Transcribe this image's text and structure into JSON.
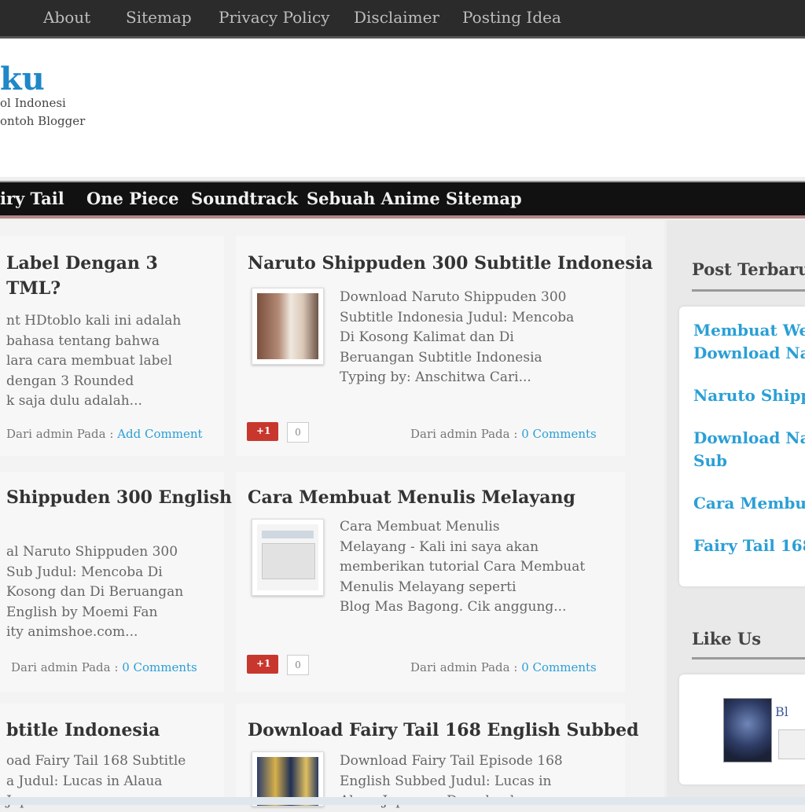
{
  "top_nav": [
    "About",
    "Sitemap",
    "Privacy Policy",
    "Disclaimer",
    "Posting Idea"
  ],
  "header": {
    "title": "ku",
    "desc_line1": "ol Indonesi",
    "desc_line2": "ontoh Blogger"
  },
  "main_nav": [
    "iry Tail",
    "One Piece",
    "Soundtrack",
    "Sebuah Anime",
    "Sitemap"
  ],
  "posts": [
    {
      "title1": "Label Dengan 3",
      "title2": "TML?",
      "snippet": [
        "nt HDtoblo kali ini adalah",
        "bahasa tentang bahwa",
        "lara cara membuat label",
        "dengan 3 Rounded",
        "k saja dulu adalah..."
      ],
      "meta_prefix": "Dari admin Pada :",
      "comments": "Add Comment"
    },
    {
      "title1": "Naruto Shippuden 300 Subtitle Indonesia",
      "snippet": [
        "Download Naruto Shippuden 300",
        "Subtitle Indonesia Judul: Mencoba",
        "Di Kosong Kalimat dan Di",
        "Beruangan Subtitle Indonesia",
        "Typing by: Anschitwa Cari..."
      ],
      "meta_prefix": "Dari admin Pada :",
      "comments": "0 Comments",
      "gplus": "+1",
      "gcount": "0"
    },
    {
      "title1": "Shippuden 300 English",
      "snippet": [
        "al Naruto Shippuden 300",
        "Sub Judul: Mencoba Di",
        "Kosong dan Di Beruangan",
        "English by Moemi Fan",
        "ity animshoe.com..."
      ],
      "meta_prefix": "Dari admin Pada :",
      "comments": "0 Comments"
    },
    {
      "title1": "Cara Membuat Menulis Melayang",
      "snippet": [
        "Cara Membuat Menulis",
        "Melayang - Kali ini saya akan",
        "memberikan tutorial Cara Membuat",
        "Menulis Melayang seperti",
        "Blog Mas Bagong. Cik anggung..."
      ],
      "meta_prefix": "Dari admin Pada :",
      "comments": "0 Comments",
      "gplus": "+1",
      "gcount": "0"
    },
    {
      "title1": "btitle Indonesia",
      "snippet": [
        "oad Fairy Tail 168 Subtitle",
        "a Judul: Lucas in Alaua",
        "Japaness"
      ]
    },
    {
      "title1": "Download Fairy Tail 168 English Subbed",
      "snippet": [
        "Download Fairy Tail Episode 168",
        "English Subbed Judul: Lucas in",
        "Alaua Japaness Download..."
      ]
    }
  ],
  "sidebar": {
    "widget1_title": "Post Terbaru",
    "links": [
      "Membuat Web",
      "Download Na",
      "Naruto Shippu",
      "Download Nar",
      "Sub",
      "Cara Membua",
      "Fairy Tail 168"
    ],
    "widget2_title": "Like Us",
    "like_name": "Bl"
  }
}
